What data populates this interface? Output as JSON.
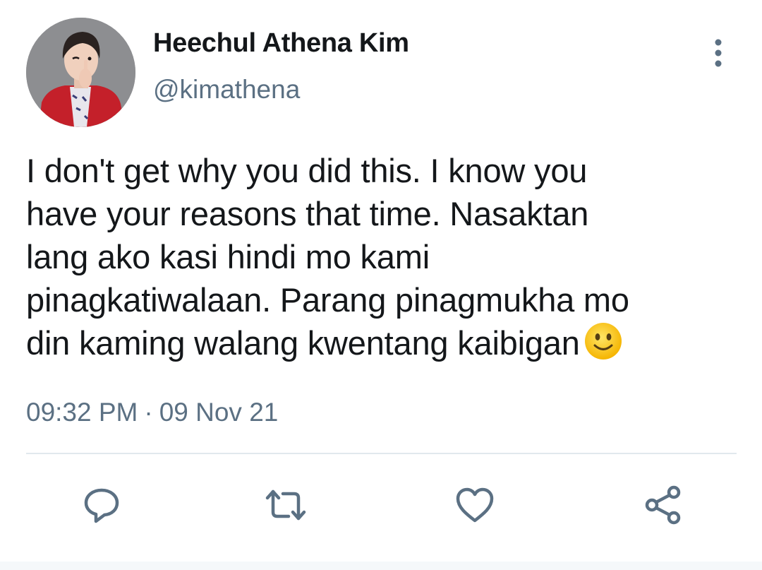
{
  "user": {
    "display_name": "Heechul Athena Kim",
    "handle": "@kimathena",
    "avatar_icon": "profile-photo"
  },
  "tweet": {
    "text": "I don't get why you did this. I know you\nhave your reasons that time. Nasaktan\nlang ako kasi hindi mo kami\npinagkatiwalaan. Parang pinagmukha mo\ndin kaming walang kwentang kaibigan",
    "emoji": "slightly-smiling-face",
    "time": "09:32 PM",
    "separator": "·",
    "date": "09 Nov 21"
  },
  "actions": [
    {
      "name": "reply",
      "icon": "comment-bubble-icon"
    },
    {
      "name": "retweet",
      "icon": "retweet-arrows-icon"
    },
    {
      "name": "like",
      "icon": "heart-icon"
    },
    {
      "name": "share",
      "icon": "share-nodes-icon"
    }
  ],
  "colors": {
    "text_primary": "#14171a",
    "text_secondary": "#5b7083",
    "icon": "#5b7083",
    "divider": "#e1e8ed"
  }
}
